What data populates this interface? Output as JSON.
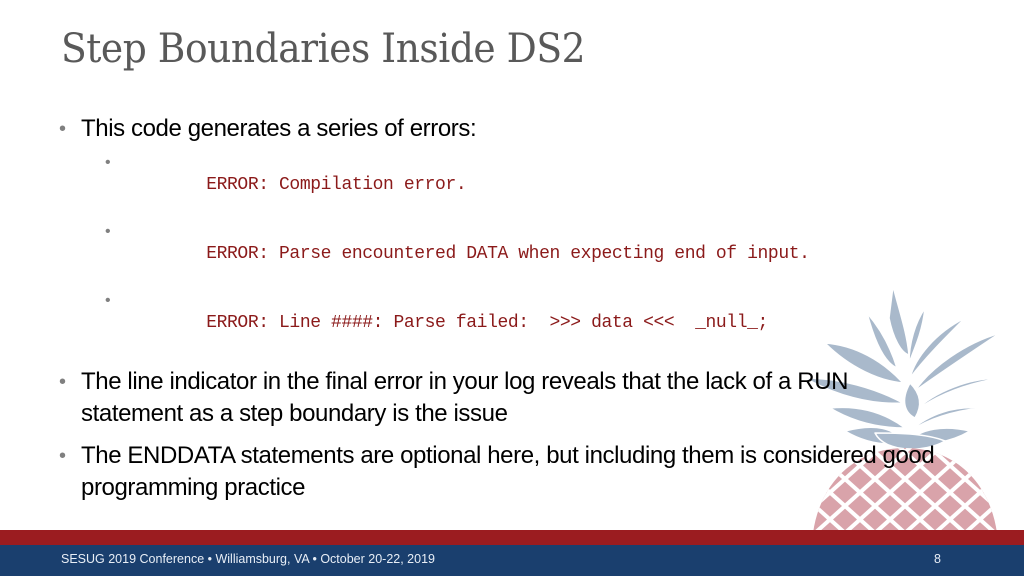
{
  "slide": {
    "title": "Step Boundaries Inside DS2",
    "bullets": [
      {
        "text": "This code generates a series of errors:",
        "sub_items": [
          "ERROR: Compilation error.",
          "ERROR: Parse encountered DATA when expecting end of input.",
          "ERROR: Line ####: Parse failed:  >>> data <<<  _null_;"
        ]
      },
      {
        "text": "The line indicator in the final error in your log reveals that the lack of a RUN statement as a step boundary is the issue"
      },
      {
        "text": "The ENDDATA statements are optional here, but including them is considered good programming practice"
      }
    ],
    "bullet_glyph": "•",
    "decoration": "pineapple-icon"
  },
  "footer": {
    "text": "SESUG 2019 Conference  •  Williamsburg, VA  •  October 20-22, 2019",
    "page_number": "8"
  },
  "colors": {
    "title": "#595959",
    "error_text": "#8b1a1a",
    "footer_red": "#9b1c20",
    "footer_blue": "#1a3f6e",
    "pineapple_leaves": "#a9b9cb",
    "pineapple_fruit": "#d9a3aa"
  }
}
